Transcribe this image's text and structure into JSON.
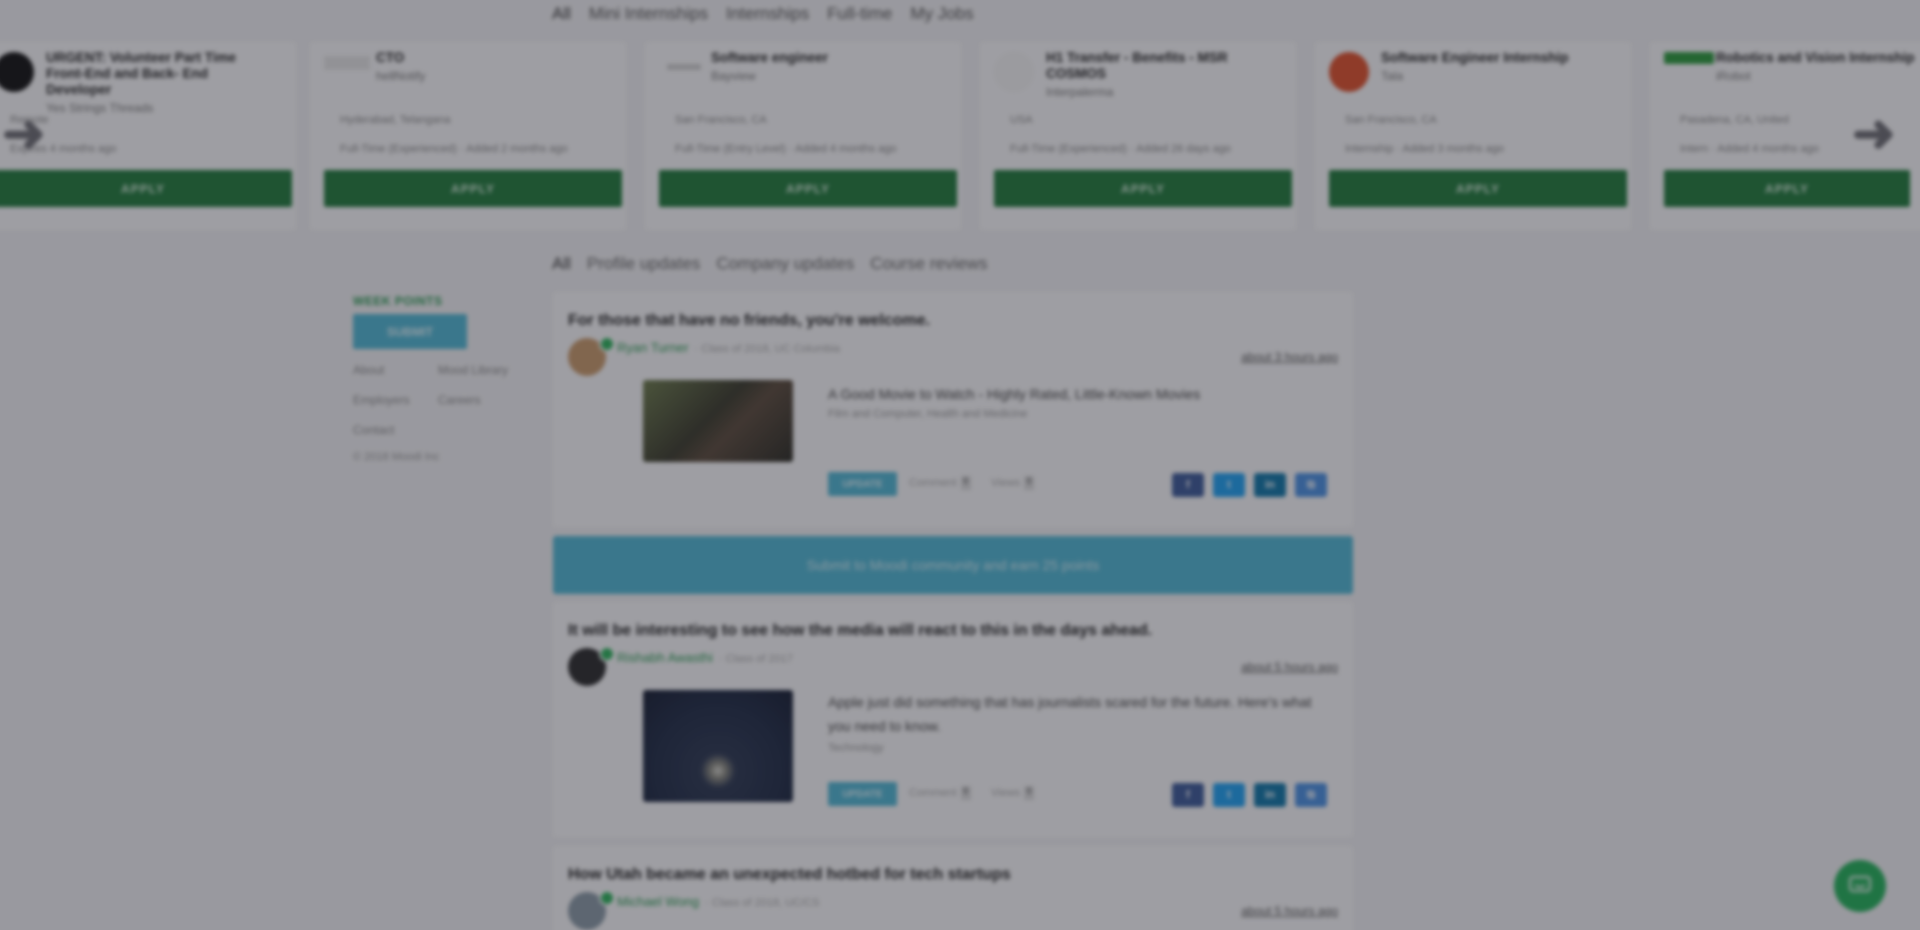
{
  "job_tabs": [
    "All",
    "Mini Internships",
    "Internships",
    "Full-time",
    "My Jobs"
  ],
  "jobs": [
    {
      "title": "URGENT: Volunteer Part Time Front-End and Back- End Developer",
      "company": "Yes Strings Threads",
      "location": "Remote",
      "meta": "Expires 4 months ago",
      "apply": "APPLY",
      "logo_color": "#111111"
    },
    {
      "title": "CTO",
      "company": "hellNotify",
      "location": "Hyderabad, Telangana",
      "meta": "Full-Time (Experienced) · Added 2 months ago",
      "apply": "APPLY",
      "logo_color": "#e0e0e0"
    },
    {
      "title": "Software engineer",
      "company": "Bayview",
      "location": "San Francisco, CA",
      "meta": "Full-Time (Entry Level) · Added 4 months ago",
      "apply": "APPLY",
      "logo_color": "#d0d0d0"
    },
    {
      "title": "H1 Transfer - Benefits - MSR COSMOS",
      "company": "Interpalerma",
      "location": "USA",
      "meta": "Full-Time (Experienced) · Added 26 days ago",
      "apply": "APPLY",
      "logo_color": "#f4f4f4"
    },
    {
      "title": "Software Engineer Internship",
      "company": "Tala",
      "location": "San Francisco, CA",
      "meta": "Internship · Added 3 months ago",
      "apply": "APPLY",
      "logo_color": "#e0502a"
    },
    {
      "title": "Robotics and Vision Internship",
      "company": "iRobot",
      "location": "Pasadena, CA, United",
      "meta": "Intern · Added 4 months ago",
      "apply": "APPLY",
      "logo_color": "#2a9a3a"
    }
  ],
  "feed_tabs": [
    "All",
    "Profile updates",
    "Company updates",
    "Course reviews"
  ],
  "sidebar": {
    "points_label": "WEEK POINTS",
    "submit_label": "SUBMIT",
    "links": [
      "About",
      "Mood Library",
      "Employers",
      "Careers",
      "Contact"
    ],
    "copyright": "© 2018 Moodi Inc"
  },
  "posts": [
    {
      "title": "For those that have no friends, you're welcome.",
      "author": "Ryan Turner",
      "author_meta": "· Class of 2018, UC Columbia",
      "time": "about 3 hours ago",
      "article_title": "A Good Movie to Watch - Highly Rated, Little-Known Movies",
      "article_cat": "Film and Computer, Health and Medicine",
      "update_label": "UPDATE",
      "comments_label": "Comment",
      "comments_count": "0",
      "views_label": "Views",
      "views_count": "0",
      "avatar_color": "#c99a6a"
    },
    {
      "title": "It will be interesting to see how the media will react to this in the days ahead.",
      "author": "Rishabh Awasthi",
      "author_meta": "· Class of 2017",
      "time": "about 5 hours ago",
      "article_title": "Apple just did something that has journalists scared for the future. Here's what you need to know.",
      "article_cat": "Technology",
      "update_label": "UPDATE",
      "comments_label": "Comment",
      "comments_count": "0",
      "views_label": "Views",
      "views_count": "0",
      "avatar_color": "#333333"
    },
    {
      "title": "How Utah became an unexpected hotbed for tech startups",
      "author": "Michael Wong",
      "author_meta": "· Class of 2018, UC/CS",
      "time": "about 5 hours ago",
      "avatar_color": "#8a9aa6"
    }
  ],
  "share_buttons": [
    "f",
    "t",
    "in",
    "⧉"
  ],
  "banner_text": "Submit to Moodi community and earn 25 points",
  "colors": {
    "green": "#1f7a3a",
    "teal": "#4fb7d4",
    "author_green": "#2a9a52"
  }
}
